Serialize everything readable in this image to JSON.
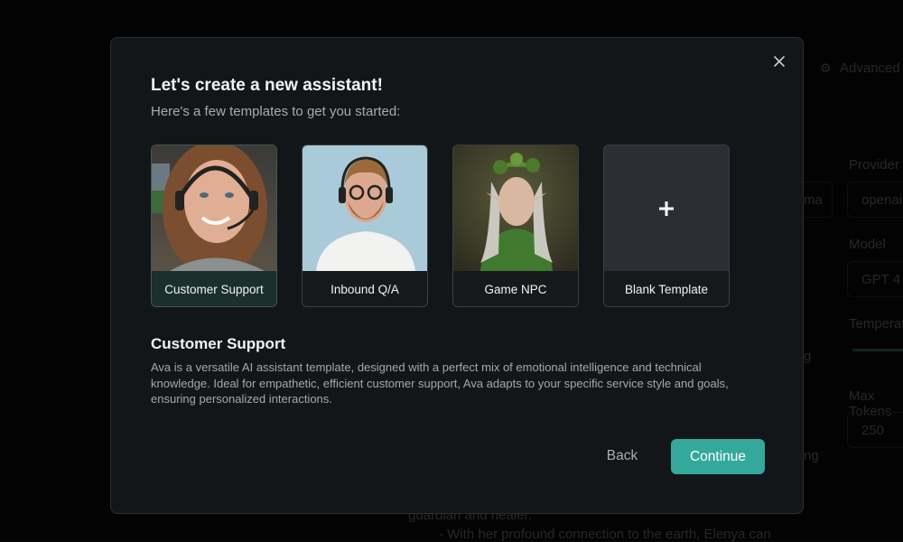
{
  "background": {
    "advanced_label": "Advanced",
    "provider_label": "Provider",
    "provider_value": "openai",
    "model_label": "Model",
    "model_value": "GPT 4",
    "temperature_label": "Temperature",
    "max_tokens_label": "Max Tokens",
    "max_tokens_value": "250",
    "text_fragment_1": "ma",
    "text_fragment_2": "g",
    "text_fragment_3": "ng",
    "text_line_1": "guardian and healer.",
    "text_line_2": "- With her profound connection to the earth, Elenya can"
  },
  "modal": {
    "title": "Let's create a new assistant!",
    "subtitle": "Here's a few templates to get you started:",
    "templates": [
      {
        "label": "Customer Support",
        "selected": true
      },
      {
        "label": "Inbound Q/A",
        "selected": false
      },
      {
        "label": "Game NPC",
        "selected": false
      },
      {
        "label": "Blank Template",
        "selected": false,
        "icon": "plus-icon"
      }
    ],
    "detail_title": "Customer Support",
    "detail_description": "Ava is a versatile AI assistant template, designed with a perfect mix of emotional intelligence and technical knowledge. Ideal for empathetic, efficient customer support, Ava adapts to your specific service style and goals, ensuring personalized interactions.",
    "back_label": "Back",
    "continue_label": "Continue",
    "accent_color": "#35a89c"
  }
}
